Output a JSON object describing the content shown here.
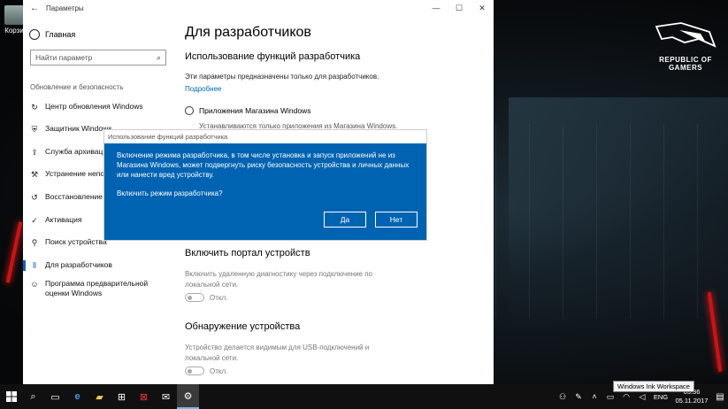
{
  "desktop": {
    "icon_label": "Корзи",
    "brand_line1": "REPUBLIC OF",
    "brand_line2": "GAMERS"
  },
  "window": {
    "title": "Параметры",
    "controls": [
      "—",
      "☐",
      "✕"
    ]
  },
  "sidebar": {
    "home": "Главная",
    "search_placeholder": "Найти параметр",
    "section": "Обновление и безопасность",
    "items": [
      {
        "label": "Центр обновления Windows",
        "icon": "sync-icon"
      },
      {
        "label": "Защитник Windows",
        "icon": "shield-icon"
      },
      {
        "label": "Служба архивации",
        "icon": "backup-icon"
      },
      {
        "label": "Устранение неполадок",
        "icon": "wrench-icon"
      },
      {
        "label": "Восстановление",
        "icon": "history-icon"
      },
      {
        "label": "Активация",
        "icon": "check-circle-icon"
      },
      {
        "label": "Поиск устройства",
        "icon": "person-pin-icon"
      },
      {
        "label": "Для разработчиков",
        "icon": "developer-icon"
      },
      {
        "label": "Программа предварительной оценки Windows",
        "icon": "insider-icon"
      }
    ]
  },
  "main": {
    "title": "Для разработчиков",
    "subhead": "Использование функций разработчика",
    "desc": "Эти параметры предназначены только для разработчиков.",
    "more": "Подробнее",
    "radio_label": "Приложения Магазина Windows",
    "radio_desc": "Устанавливаются только приложения из Магазина Windows.",
    "portal_head": "Включить портал устройств",
    "portal_desc": "Включить удаленную диагностику через подключение по локальной сети.",
    "portal_toggle": "Откл.",
    "discovery_head": "Обнаружение устройства",
    "discovery_desc": "Устройство делается видимым для USB-подключений и локальной сети.",
    "discovery_toggle": "Откл."
  },
  "dialog": {
    "title": "Использование функций разработчика",
    "message": "Включение режима разработчика, в том числе установка и запуск приложений не из Магазина Windows, может подвергнуть риску безопасность устройства и личных данных или нанести вред устройству.",
    "question": "Включить режим разработчика?",
    "yes": "Да",
    "no": "Нет"
  },
  "taskbar": {
    "lang": "ENG",
    "time": "03:36",
    "date": "05.11.2017",
    "tooltip": "Windows Ink Workspace"
  },
  "colors": {
    "accent": "#0067b8",
    "dialog_bg": "#0063b1",
    "taskbar": "#101010"
  }
}
